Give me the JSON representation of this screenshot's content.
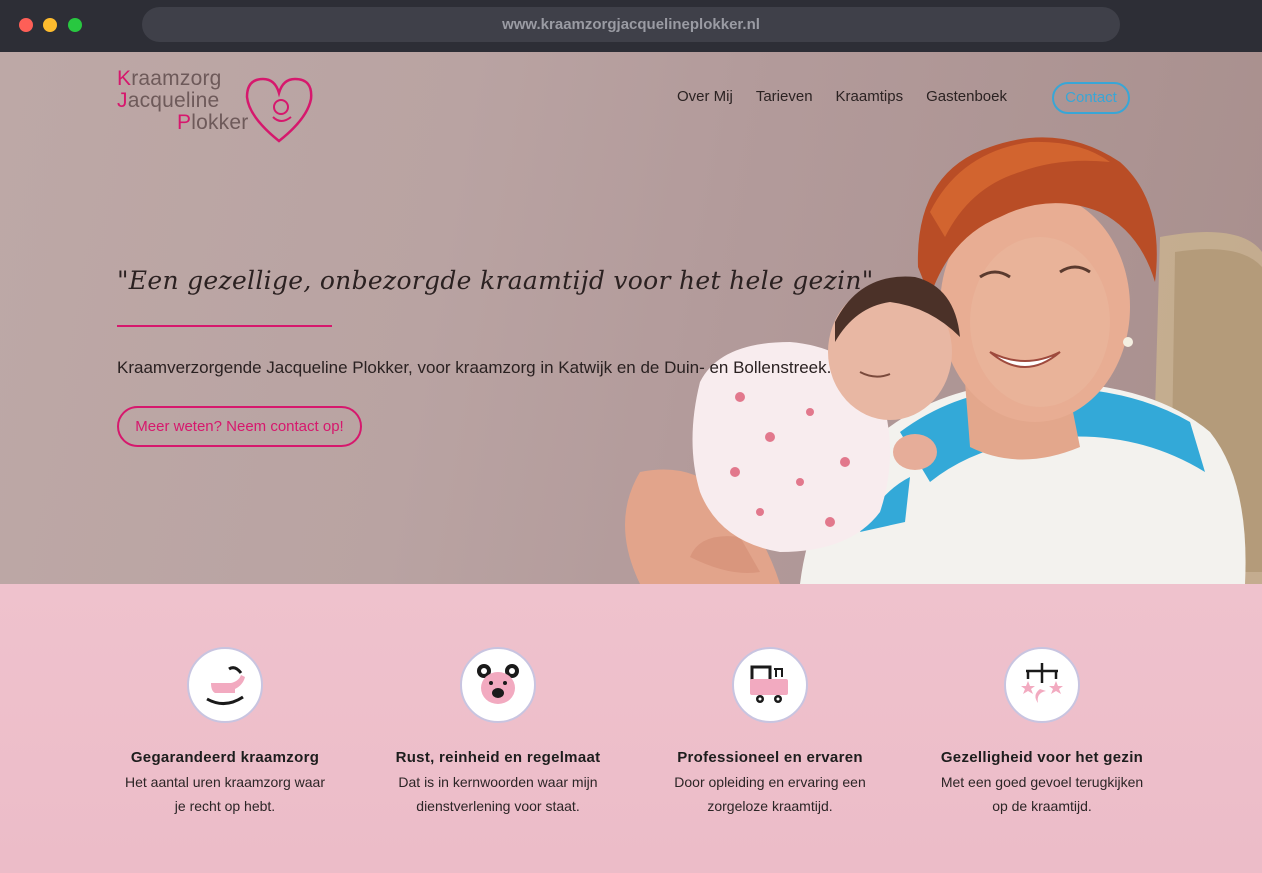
{
  "browser": {
    "url": "www.kraamzorgjacquelineplokker.nl"
  },
  "logo": {
    "line1_initial": "K",
    "line1_rest": "raamzorg",
    "line2_initial": "J",
    "line2_rest": "acqueline",
    "line3_initial": "P",
    "line3_rest": "lokker"
  },
  "nav": {
    "items": [
      {
        "label": "Over Mij"
      },
      {
        "label": "Tarieven"
      },
      {
        "label": "Kraamtips"
      },
      {
        "label": "Gastenboek"
      }
    ],
    "contact_label": "Contact"
  },
  "hero": {
    "tagline": "\"Een gezellige, onbezorgde kraamtijd voor het hele gezin\"",
    "lead": "Kraamverzorgende Jacqueline Plokker, voor kraamzorg in Katwijk en de Duin- en Bollenstreek.",
    "cta_label": "Meer weten? Neem contact op!"
  },
  "features": [
    {
      "icon": "rocking-horse-icon",
      "title": "Gegarandeerd kraamzorg",
      "text": "Het aantal uren kraamzorg waar je recht op hebt."
    },
    {
      "icon": "teddy-bear-icon",
      "title": "Rust, reinheid en regelmaat",
      "text": "Dat is in kernwoorden waar mijn dienstverlening voor staat."
    },
    {
      "icon": "toy-cart-icon",
      "title": "Professioneel en ervaren",
      "text": "Door opleiding en ervaring een zorgeloze kraamtijd."
    },
    {
      "icon": "baby-mobile-icon",
      "title": "Gezelligheid voor het gezin",
      "text": "Met een goed gevoel terugkijken op de kraamtijd."
    }
  ],
  "colors": {
    "brand_pink": "#d6186d",
    "contact_blue": "#39a6d6",
    "features_bg": "#efc2cd",
    "icon_pink": "#f2aac0"
  }
}
